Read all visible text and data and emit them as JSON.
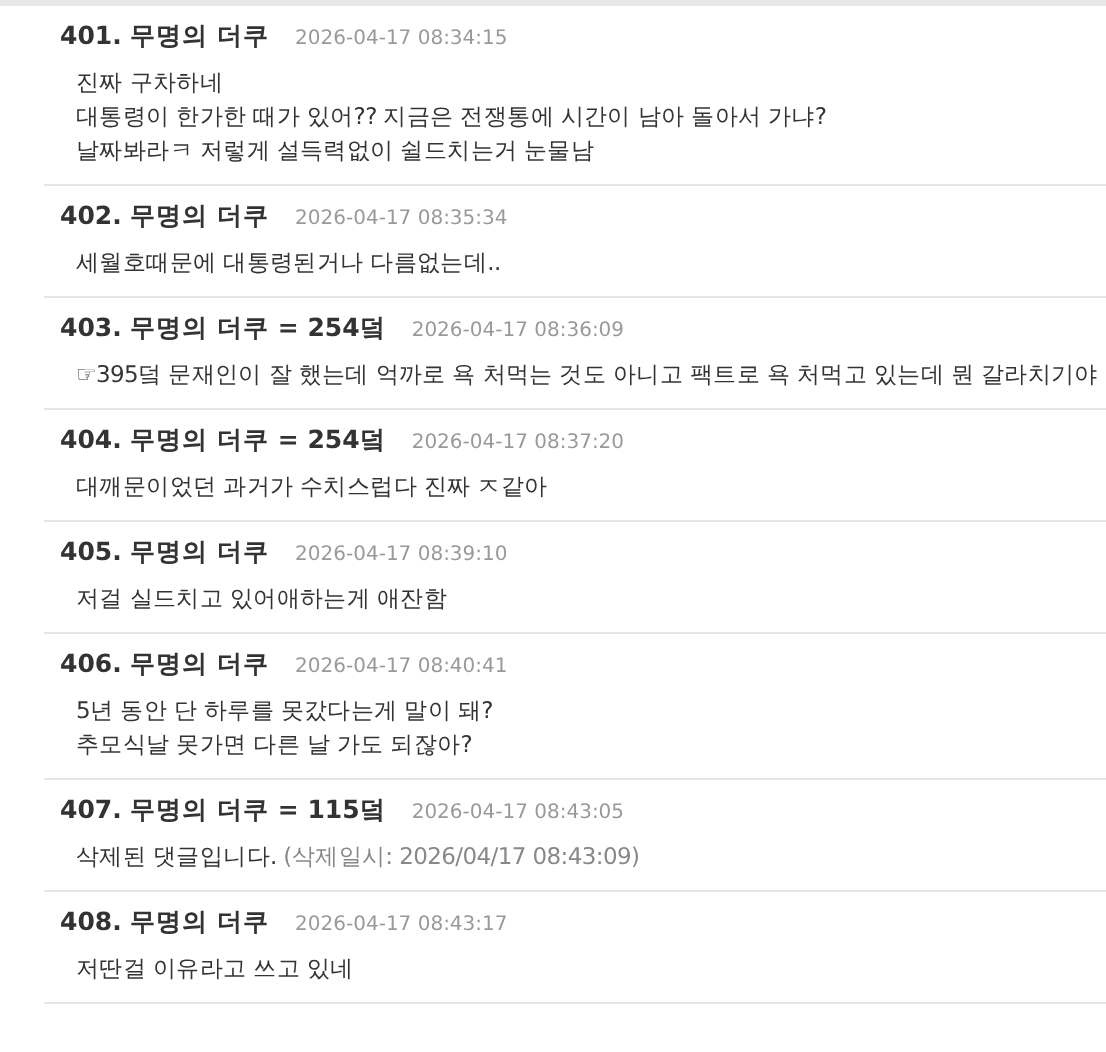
{
  "comments": [
    {
      "title": "401. 무명의 더쿠",
      "time": "2026-04-17 08:34:15",
      "lines": [
        {
          "kind": "text",
          "text": "진짜 구차하네"
        },
        {
          "kind": "text",
          "text": "대통령이 한가한 때가 있어?? 지금은 전쟁통에 시간이 남아 돌아서 가냐?"
        },
        {
          "kind": "text",
          "text": "날짜봐라ㅋ 저렇게 설득력없이 쉴드치는거 눈물남"
        }
      ]
    },
    {
      "title": "402. 무명의 더쿠",
      "time": "2026-04-17 08:35:34",
      "lines": [
        {
          "kind": "text",
          "text": "세월호때문에 대통령된거나 다름없는데.."
        }
      ]
    },
    {
      "title": "403. 무명의 더쿠 = 254덬",
      "time": "2026-04-17 08:36:09",
      "lines": [
        {
          "kind": "text",
          "text": "☞395덬 문재인이 잘 했는데 억까로 욕 처먹는 것도 아니고 팩트로 욕 처먹고 있는데 뭔 갈라치기야"
        }
      ]
    },
    {
      "title": "404. 무명의 더쿠 = 254덬",
      "time": "2026-04-17 08:37:20",
      "lines": [
        {
          "kind": "text",
          "text": "대깨문이었던 과거가 수치스럽다 진짜 ㅈ같아"
        }
      ]
    },
    {
      "title": "405. 무명의 더쿠",
      "time": "2026-04-17 08:39:10",
      "lines": [
        {
          "kind": "text",
          "text": "저걸 실드치고 있어애하는게 애잔함"
        }
      ]
    },
    {
      "title": "406. 무명의 더쿠",
      "time": "2026-04-17 08:40:41",
      "lines": [
        {
          "kind": "text",
          "text": "5년 동안 단 하루를 못갔다는게 말이 돼?"
        },
        {
          "kind": "text",
          "text": "추모식날 못가면 다른 날 가도 되잖아?"
        }
      ]
    },
    {
      "title": "407. 무명의 더쿠 = 115덬",
      "time": "2026-04-17 08:43:05",
      "lines": [
        {
          "kind": "deleted",
          "text": "삭제된 댓글입니다.",
          "note": "(삭제일시: 2026/04/17 08:43:09)"
        }
      ]
    },
    {
      "title": "408. 무명의 더쿠",
      "time": "2026-04-17 08:43:17",
      "lines": [
        {
          "kind": "text",
          "text": "저딴걸 이유라고 쓰고 있네"
        }
      ]
    }
  ]
}
